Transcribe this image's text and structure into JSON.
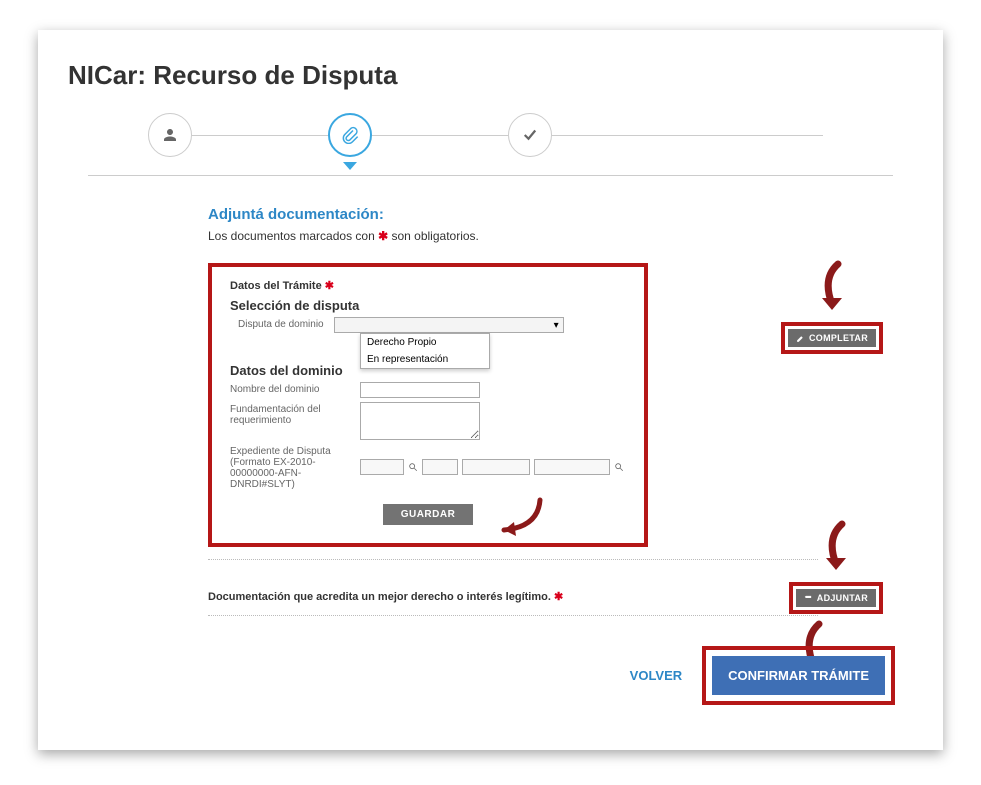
{
  "page": {
    "title": "NICar: Recurso de Disputa"
  },
  "stepper": {
    "steps": [
      "person",
      "attachment",
      "check"
    ],
    "activeIndex": 1
  },
  "attach": {
    "title": "Adjuntá documentación:",
    "note_prefix": "Los documentos marcados con ",
    "note_suffix": " son obligatorios."
  },
  "tramite": {
    "header": "Datos del Trámite",
    "seleccion_title": "Selección de disputa",
    "seleccion_label": "Disputa de dominio",
    "dropdown_options": [
      "Derecho Propio",
      "En representación"
    ],
    "dominio_title": "Datos del dominio",
    "nombre_label": "Nombre del dominio",
    "fundamentacion_label": "Fundamentación del requerimiento",
    "expediente_label": "Expediente de Disputa",
    "expediente_formato": "(Formato EX-2010-00000000-AFN-DNRDI#SLYT)",
    "guardar": "GUARDAR"
  },
  "doc_legitimo": {
    "label": "Documentación que acredita un mejor derecho o interés legítimo."
  },
  "buttons": {
    "completar": "COMPLETAR",
    "adjuntar": "ADJUNTAR",
    "volver": "VOLVER",
    "confirmar": "CONFIRMAR TRÁMITE"
  }
}
